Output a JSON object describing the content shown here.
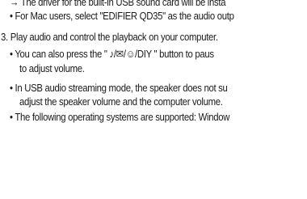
{
  "doc": {
    "lines": [
      {
        "kind": "arrow",
        "prefix": "→",
        "text": " The driver for the built-in USB sound card will be insta"
      },
      {
        "kind": "bullet",
        "prefix": "•",
        "text": " For Mac users, select \"EDIFIER QD35\" as the audio outp"
      },
      {
        "kind": "step",
        "prefix": "3.",
        "text": " Play audio and control the playback on your computer."
      },
      {
        "kind": "bullet",
        "prefix": "•",
        "text": " You can also press the \" ♪/✉/☺/DIY \" button to paus"
      },
      {
        "kind": "cont",
        "prefix": "",
        "text": "to adjust volume."
      },
      {
        "kind": "bullet",
        "prefix": "•",
        "text": " In USB audio streaming mode, the speaker does not su"
      },
      {
        "kind": "cont",
        "prefix": "",
        "text": "adjust the speaker volume and the computer volume."
      },
      {
        "kind": "bullet",
        "prefix": "•",
        "text": " The following operating systems are supported: Window"
      }
    ]
  }
}
